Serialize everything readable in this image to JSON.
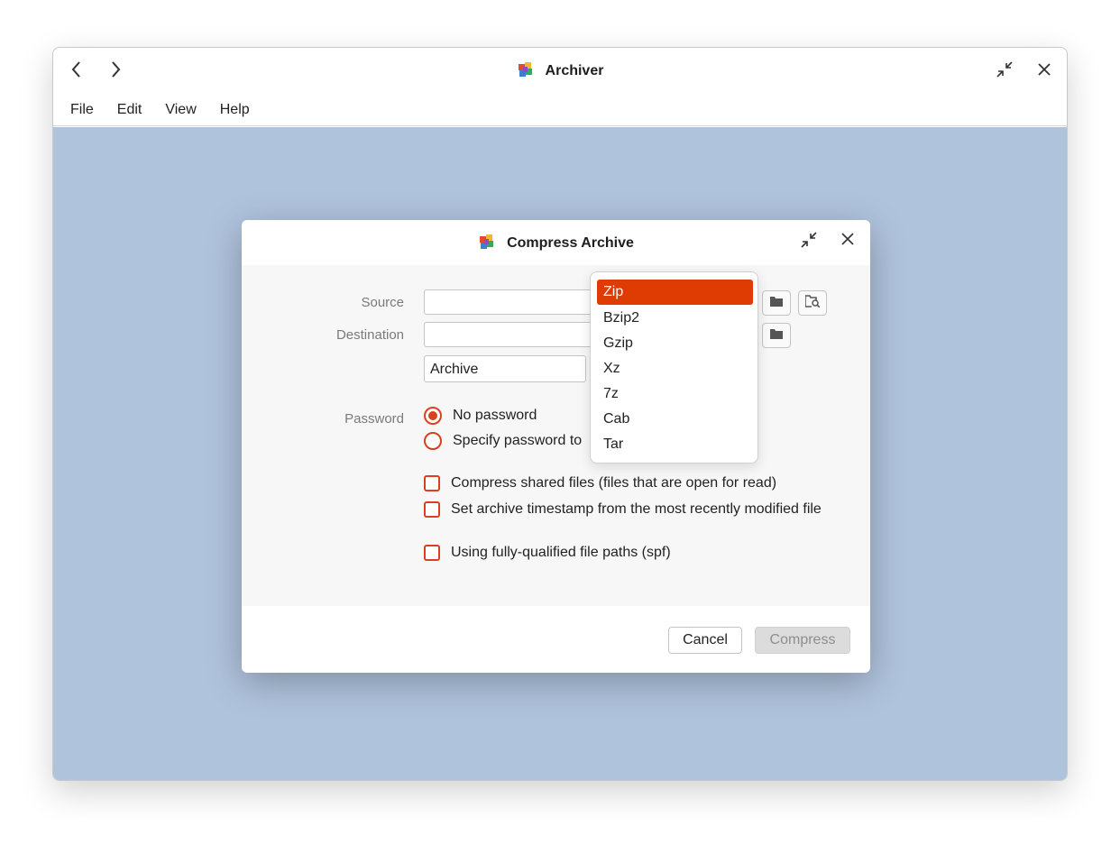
{
  "app": {
    "title": "Archiver",
    "menu": [
      "File",
      "Edit",
      "View",
      "Help"
    ]
  },
  "dialog": {
    "title": "Compress Archive",
    "labels": {
      "source": "Source",
      "destination": "Destination",
      "password": "Password"
    },
    "source_value": "",
    "destination_value": "",
    "archive_name": "Archive",
    "password_options": [
      {
        "label": "No password",
        "selected": true
      },
      {
        "label": "Specify password to",
        "selected": false
      }
    ],
    "checkboxes": [
      {
        "label": "Compress shared files (files that are open for read)",
        "checked": false
      },
      {
        "label": "Set archive timestamp from the most recently modified file",
        "checked": false
      },
      {
        "label": "Using fully-qualified file paths (spf)",
        "checked": false
      }
    ],
    "buttons": {
      "cancel": "Cancel",
      "compress": "Compress"
    },
    "format_dropdown": {
      "selected": "Zip",
      "options": [
        "Zip",
        "Bzip2",
        "Gzip",
        "Xz",
        "7z",
        "Cab",
        "Tar"
      ]
    }
  },
  "colors": {
    "accent": "#de3c03",
    "workspace": "#b0c3dd"
  },
  "icons": {
    "back": "chevron-left-icon",
    "forward": "chevron-right-icon",
    "app": "archiver-app-icon",
    "restore": "restore-down-icon",
    "close": "close-icon",
    "folder": "folder-icon",
    "browse": "folder-search-icon"
  }
}
